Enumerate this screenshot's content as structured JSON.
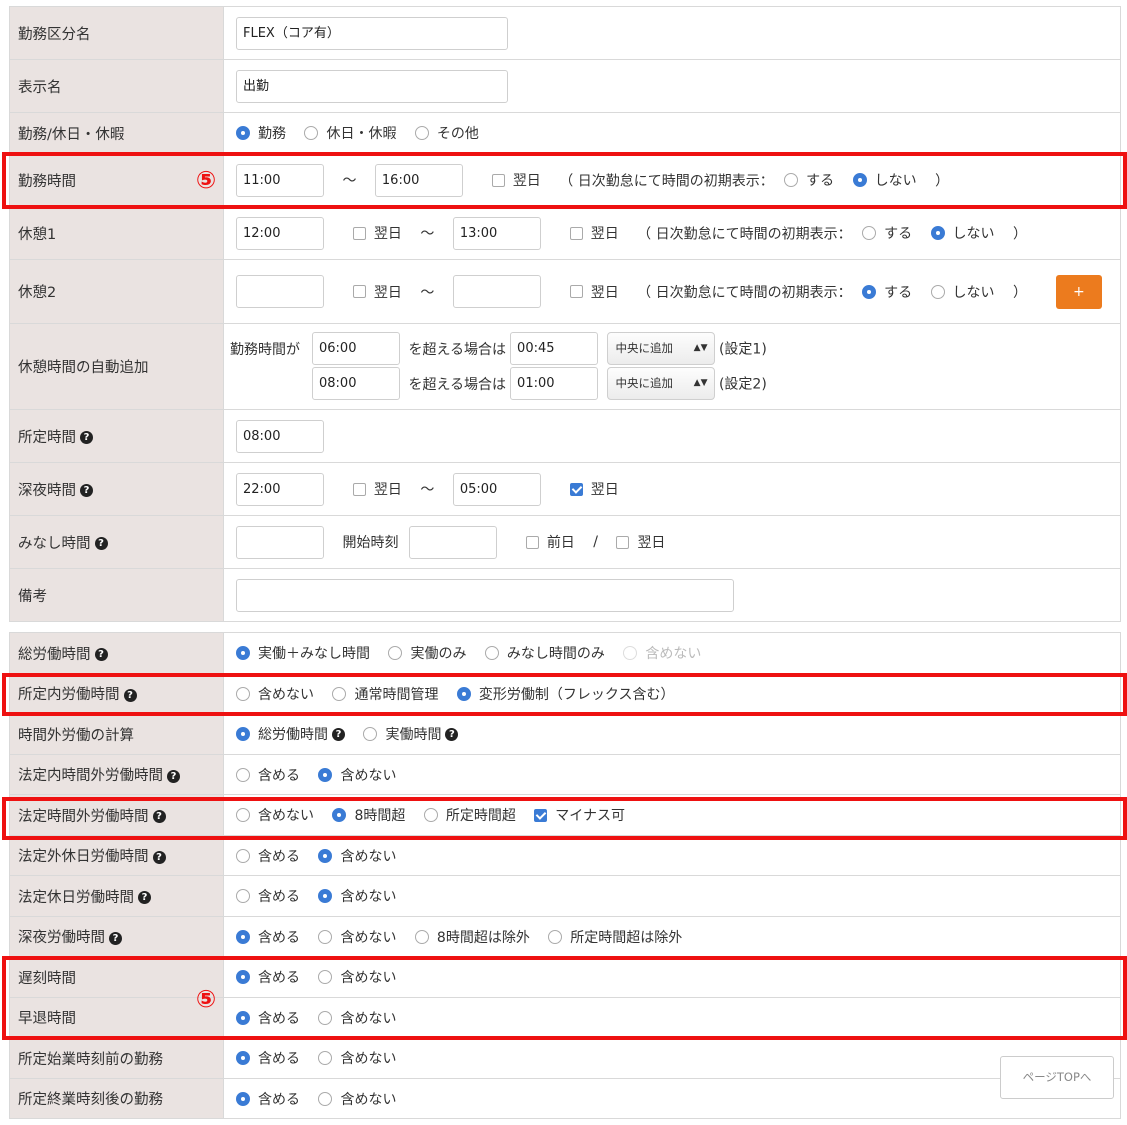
{
  "rows": {
    "kinmu_kubun": {
      "label": "勤務区分名",
      "value": "FLEX（コア有）"
    },
    "hyoji": {
      "label": "表示名",
      "value": "出勤"
    },
    "kinmu_kyujitsu": {
      "label": "勤務/休日・休暇",
      "opt1": "勤務",
      "opt2": "休日・休暇",
      "opt3": "その他"
    },
    "kinmu_jikan": {
      "label": "勤務時間",
      "start": "11:00",
      "tilde": "〜",
      "end": "16:00",
      "yokujitsu": "翌日",
      "paren_open": "（ 日次勤怠にて時間の初期表示：",
      "suru": "する",
      "shinai": "しない",
      "paren_close": "）"
    },
    "kyukei1": {
      "label": "休憩1",
      "start": "12:00",
      "end": "13:00",
      "yokujitsu": "翌日",
      "tilde": "〜",
      "paren_open": "（ 日次勤怠にて時間の初期表示：",
      "suru": "する",
      "shinai": "しない",
      "paren_close": "）"
    },
    "kyukei2": {
      "label": "休憩2",
      "start": "",
      "end": "",
      "yokujitsu": "翌日",
      "tilde": "〜",
      "paren_open": "（ 日次勤怠にて時間の初期表示：",
      "suru": "する",
      "shinai": "しない",
      "paren_close": "）",
      "add_button": "+"
    },
    "auto_add": {
      "label": "休憩時間の自動追加",
      "prefix": "勤務時間が",
      "exceed": "を超える場合は",
      "line1": {
        "work": "06:00",
        "break": "00:45",
        "position": "中央に追加",
        "setting": "(設定1)"
      },
      "line2": {
        "work": "08:00",
        "break": "01:00",
        "position": "中央に追加",
        "setting": "(設定2)"
      }
    },
    "shotei": {
      "label": "所定時間",
      "value": "08:00"
    },
    "shinya": {
      "label": "深夜時間",
      "start": "22:00",
      "end": "05:00",
      "yokujitsu": "翌日",
      "tilde": "〜"
    },
    "minashi": {
      "label": "みなし時間",
      "start_label": "開始時刻",
      "zenjitsu": "前日",
      "slash": "/",
      "yokujitsu": "翌日"
    },
    "biko": {
      "label": "備考",
      "value": ""
    }
  },
  "rows2": {
    "so_rodo": {
      "label": "総労働時間",
      "opt1": "実働＋みなし時間",
      "opt2": "実働のみ",
      "opt3": "みなし時間のみ",
      "opt4": "含めない"
    },
    "shoteinai": {
      "label": "所定内労働時間",
      "opt1": "含めない",
      "opt2": "通常時間管理",
      "opt3": "変形労働制（フレックス含む）"
    },
    "jikangai_keisan": {
      "label": "時間外労働の計算",
      "opt1": "総労働時間",
      "opt2": "実働時間"
    },
    "hoteinai_jikangai": {
      "label": "法定内時間外労働時間",
      "opt1": "含める",
      "opt2": "含めない"
    },
    "hotei_jikangai": {
      "label": "法定時間外労働時間",
      "opt1": "含めない",
      "opt2": "8時間超",
      "opt3": "所定時間超",
      "opt4": "マイナス可"
    },
    "hoteigai_kyujitsu": {
      "label": "法定外休日労働時間",
      "opt1": "含める",
      "opt2": "含めない"
    },
    "hotei_kyujitsu": {
      "label": "法定休日労働時間",
      "opt1": "含める",
      "opt2": "含めない"
    },
    "shinya_rodo": {
      "label": "深夜労働時間",
      "opt1": "含める",
      "opt2": "含めない",
      "opt3": "8時間超は除外",
      "opt4": "所定時間超は除外"
    },
    "chikoku": {
      "label": "遅刻時間",
      "opt1": "含める",
      "opt2": "含めない"
    },
    "sotai": {
      "label": "早退時間",
      "opt1": "含める",
      "opt2": "含めない"
    },
    "shigyo_mae": {
      "label": "所定始業時刻前の勤務",
      "opt1": "含める",
      "opt2": "含めない"
    },
    "shugyo_go": {
      "label": "所定終業時刻後の勤務",
      "opt1": "含める",
      "opt2": "含めない"
    }
  },
  "annotation_number": "⑤",
  "annotation_color": "#ee1111",
  "accent_color": "#3a7bd5",
  "add_button_color": "#ec7b1e",
  "page_top": "ページTOPへ"
}
